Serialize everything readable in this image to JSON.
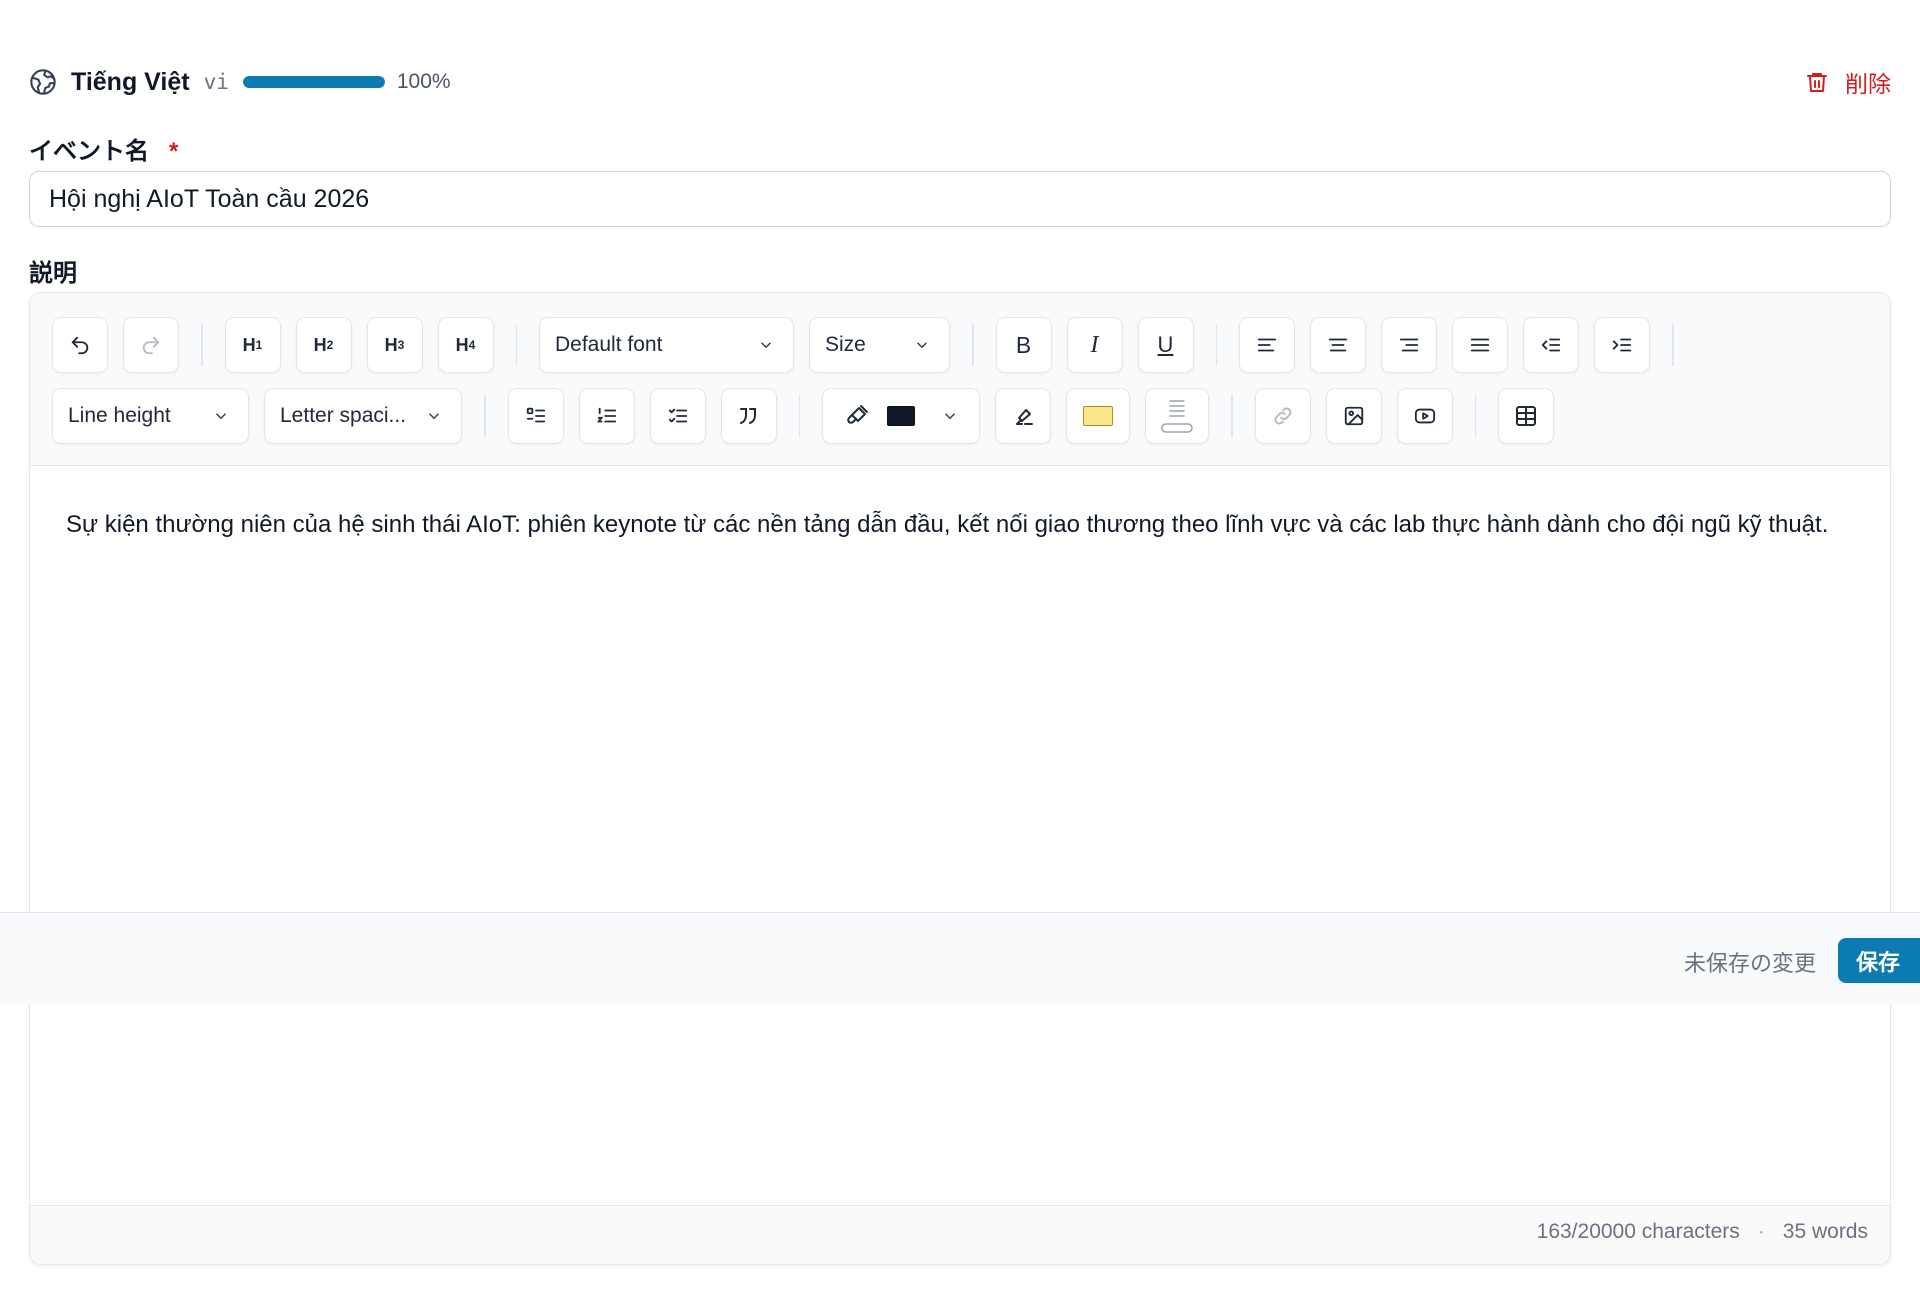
{
  "language": {
    "name": "Tiếng Việt",
    "code": "vi",
    "progress_percent": 100,
    "progress_label": "100%",
    "delete_label": "削除"
  },
  "fields": {
    "name_label": "イベント名",
    "required_mark": "*",
    "name_value": "Hội nghị AIoT Toàn cầu 2026",
    "description_label": "説明"
  },
  "toolbar": {
    "headings": [
      "H",
      "H",
      "H",
      "H"
    ],
    "heading_levels": [
      "1",
      "2",
      "3",
      "4"
    ],
    "font_select": "Default font",
    "size_select": "Size",
    "bold": "B",
    "italic": "I",
    "underline": "U",
    "line_height_select": "Line height",
    "letter_spacing_select": "Letter spaci...",
    "text_color": "#111827",
    "highlight_color": "#fde68a"
  },
  "editor": {
    "content": "Sự kiện thường niên của hệ sinh thái AIoT: phiên keynote từ các nền tảng dẫn đầu, kết nối giao thương theo lĩnh vực và các lab thực hành dành cho đội ngũ kỹ thuật.",
    "characters": "163/20000 characters",
    "separator": "·",
    "words": "35 words"
  },
  "save_bar": {
    "unsaved_label": "未保存の変更",
    "save_label": "保存"
  },
  "colors": {
    "accent": "#0c7bb3",
    "danger": "#d11f1f"
  }
}
